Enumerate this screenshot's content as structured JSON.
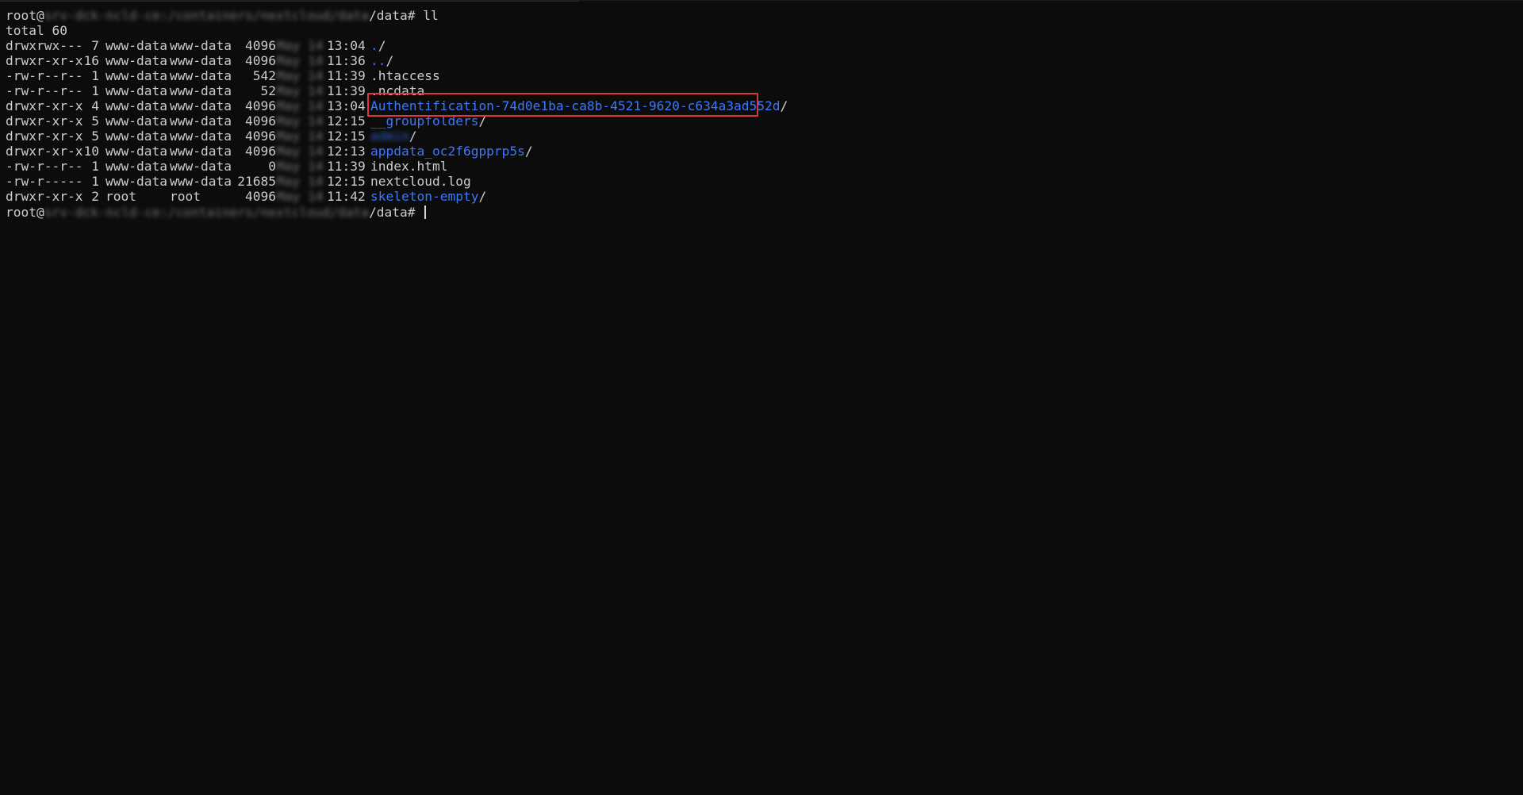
{
  "terminal": {
    "prompt_1": {
      "user": "root@",
      "host_path_hidden": "srv-dck-ncld-ce:/containers/nextcloud/data",
      "path_suffix": "/data# ",
      "command": "ll"
    },
    "total": "total 60",
    "entries": [
      {
        "perms": "drwxrwx---",
        "links": "7",
        "owner": "www-data",
        "group": "www-data",
        "size": "4096",
        "date_hidden": "May 14",
        "time": "13:04",
        "name": ".",
        "slash": "/",
        "is_dir": true
      },
      {
        "perms": "drwxr-xr-x",
        "links": "16",
        "owner": "www-data",
        "group": "www-data",
        "size": "4096",
        "date_hidden": "May 14",
        "time": "11:36",
        "name": "..",
        "slash": "/",
        "is_dir": true
      },
      {
        "perms": "-rw-r--r--",
        "links": "1",
        "owner": "www-data",
        "group": "www-data",
        "size": "542",
        "date_hidden": "May 14",
        "time": "11:39",
        "name": ".htaccess",
        "slash": "",
        "is_dir": false
      },
      {
        "perms": "-rw-r--r--",
        "links": "1",
        "owner": "www-data",
        "group": "www-data",
        "size": "52",
        "date_hidden": "May 14",
        "time": "11:39",
        "name": ".ncdata",
        "slash": "",
        "is_dir": false
      },
      {
        "perms": "drwxr-xr-x",
        "links": "4",
        "owner": "www-data",
        "group": "www-data",
        "size": "4096",
        "date_hidden": "May 14",
        "time": "13:04",
        "name": "Authentification-74d0e1ba-ca8b-4521-9620-c634a3ad552d",
        "slash": "/",
        "is_dir": true
      },
      {
        "perms": "drwxr-xr-x",
        "links": "5",
        "owner": "www-data",
        "group": "www-data",
        "size": "4096",
        "date_hidden": "May 14",
        "time": "12:15",
        "name": "__groupfolders",
        "slash": "/",
        "is_dir": true
      },
      {
        "perms": "drwxr-xr-x",
        "links": "5",
        "owner": "www-data",
        "group": "www-data",
        "size": "4096",
        "date_hidden": "May 14",
        "time": "12:15",
        "name": "admin",
        "slash": "/",
        "is_dir": true,
        "name_hidden": true
      },
      {
        "perms": "drwxr-xr-x",
        "links": "10",
        "owner": "www-data",
        "group": "www-data",
        "size": "4096",
        "date_hidden": "May 14",
        "time": "12:13",
        "name": "appdata_oc2f6gpprp5s",
        "slash": "/",
        "is_dir": true
      },
      {
        "perms": "-rw-r--r--",
        "links": "1",
        "owner": "www-data",
        "group": "www-data",
        "size": "0",
        "date_hidden": "May 14",
        "time": "11:39",
        "name": "index.html",
        "slash": "",
        "is_dir": false
      },
      {
        "perms": "-rw-r-----",
        "links": "1",
        "owner": "www-data",
        "group": "www-data",
        "size": "21685",
        "date_hidden": "May 14",
        "time": "12:15",
        "name": "nextcloud.log",
        "slash": "",
        "is_dir": false
      },
      {
        "perms": "drwxr-xr-x",
        "links": "2",
        "owner": "root",
        "group": "root",
        "size": "4096",
        "date_hidden": "May 14",
        "time": "11:42",
        "name": "skeleton-empty",
        "slash": "/",
        "is_dir": true
      }
    ],
    "prompt_2": {
      "user": "root@",
      "host_path_hidden": "srv-dck-ncld-ce:/containers/nextcloud/data",
      "path_suffix": "/data# ",
      "command": ""
    },
    "colors": {
      "background": "#0c0c0c",
      "text": "#cccccc",
      "directory": "#3b78ff",
      "highlight_box": "#e0353a"
    }
  }
}
